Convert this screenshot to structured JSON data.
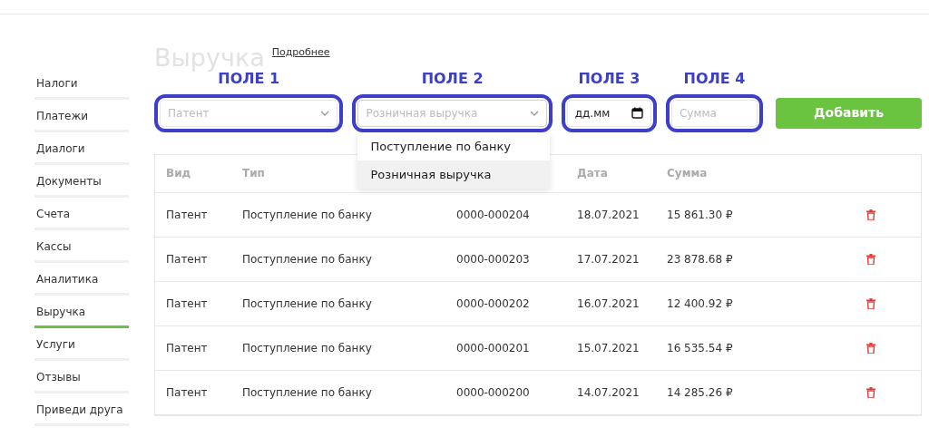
{
  "sidebar": {
    "items": [
      {
        "label": "Налоги",
        "selected": false
      },
      {
        "label": "Платежи",
        "selected": false
      },
      {
        "label": "Диалоги",
        "selected": false
      },
      {
        "label": "Документы",
        "selected": false
      },
      {
        "label": "Счета",
        "selected": false
      },
      {
        "label": "Кассы",
        "selected": false
      },
      {
        "label": "Аналитика",
        "selected": false
      },
      {
        "label": "Выручка",
        "selected": true
      },
      {
        "label": "Услуги",
        "selected": false
      },
      {
        "label": "Отзывы",
        "selected": false
      },
      {
        "label": "Приведи друга",
        "selected": false
      }
    ]
  },
  "page": {
    "title": "Выручка",
    "details_link": "Подробнее"
  },
  "form": {
    "fields": [
      {
        "kind": "select",
        "annotation": "ПОЛЕ 1",
        "placeholder": "Патент"
      },
      {
        "kind": "select",
        "annotation": "ПОЛЕ 2",
        "placeholder": "Розничная выручка",
        "expanded": true,
        "options": [
          {
            "label": "Поступление по банку",
            "selected": false
          },
          {
            "label": "Розничная выручка",
            "selected": true
          }
        ]
      },
      {
        "kind": "date",
        "annotation": "ПОЛЕ 3",
        "value": "дд.мм"
      },
      {
        "kind": "text",
        "annotation": "ПОЛЕ 4",
        "placeholder": "Сумма"
      }
    ],
    "submit": "Добавить"
  },
  "table": {
    "columns": [
      "Вид",
      "Тип",
      "Дата",
      "Сумма"
    ],
    "rows": [
      {
        "kind": "Патент",
        "type": "Поступление по банку",
        "number": "0000-000204",
        "date": "18.07.2021",
        "sum": "15 861.30 ₽"
      },
      {
        "kind": "Патент",
        "type": "Поступление по банку",
        "number": "0000-000203",
        "date": "17.07.2021",
        "sum": "23 878.68 ₽"
      },
      {
        "kind": "Патент",
        "type": "Поступление по банку",
        "number": "0000-000202",
        "date": "16.07.2021",
        "sum": "12 400.92 ₽"
      },
      {
        "kind": "Патент",
        "type": "Поступление по банку",
        "number": "0000-000201",
        "date": "15.07.2021",
        "sum": "16 535.54 ₽"
      },
      {
        "kind": "Патент",
        "type": "Поступление по банку",
        "number": "0000-000200",
        "date": "14.07.2021",
        "sum": "14 285.26 ₽"
      }
    ]
  }
}
